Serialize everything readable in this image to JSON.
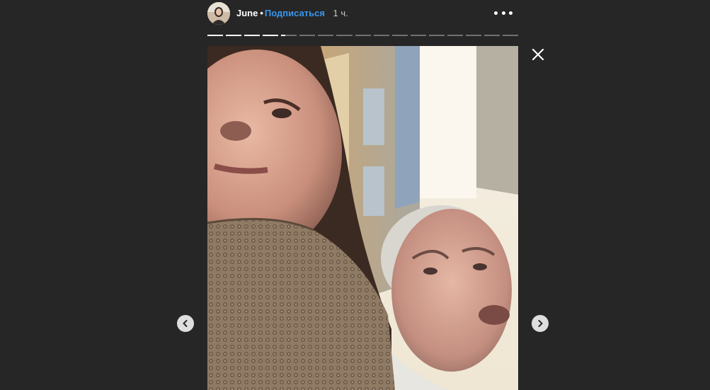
{
  "header": {
    "username": "June",
    "separator": "•",
    "follow_label": "Подписаться",
    "timestamp": "1 ч.",
    "more_icon": "more-horizontal-icon"
  },
  "progress": {
    "segment_count": 17,
    "completed_segments": 4,
    "current_segment_progress": 0.25
  },
  "story": {
    "media_type": "image"
  },
  "controls": {
    "close_icon": "close-icon",
    "prev_icon": "chevron-left-icon",
    "next_icon": "chevron-right-icon"
  },
  "colors": {
    "background": "#262626",
    "follow_link": "#3897f0",
    "text": "#ffffff",
    "muted_text": "#c7c7c7"
  }
}
